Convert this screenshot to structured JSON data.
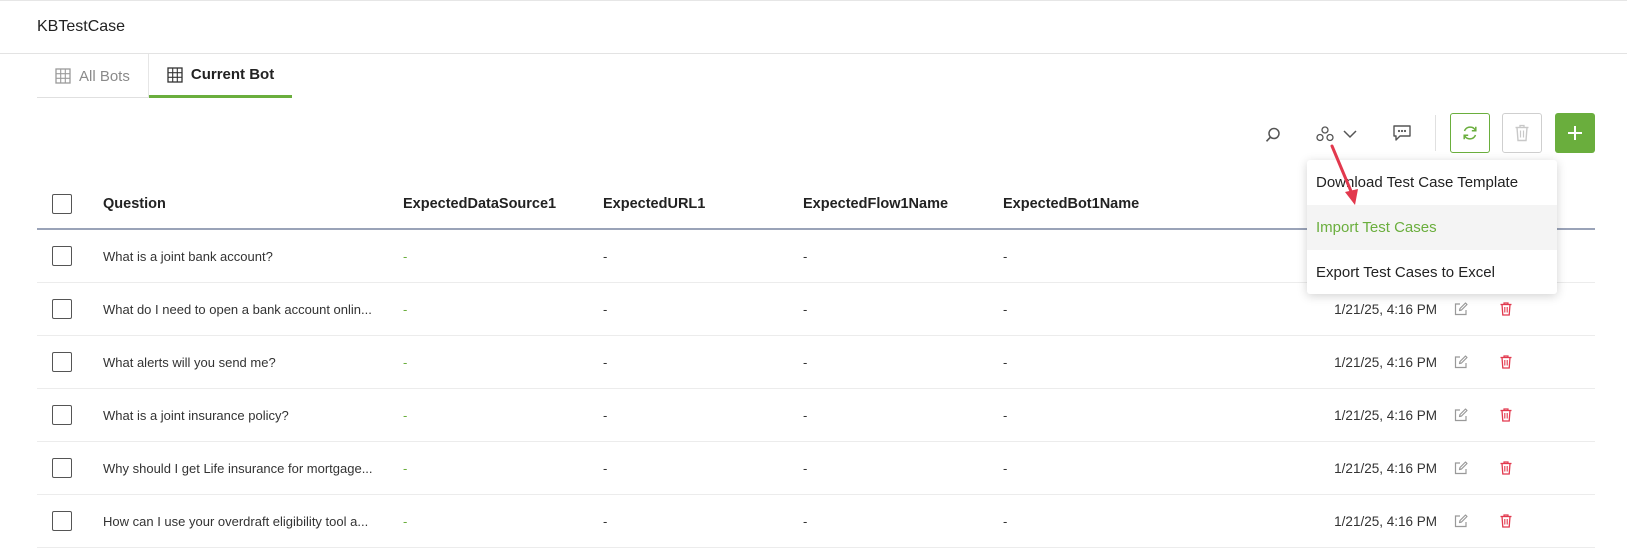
{
  "app": {
    "title": "KBTestCase"
  },
  "tabs": [
    {
      "label": "All Bots",
      "active": false
    },
    {
      "label": "Current Bot",
      "active": true
    }
  ],
  "colors": {
    "accent": "#6aae3d",
    "danger": "#e2384d",
    "header_rule": "#9aa3b8"
  },
  "toolbar": {
    "icons": [
      "search-icon",
      "group-icon",
      "chevron-down-icon",
      "comment-icon",
      "refresh-icon",
      "trash-icon",
      "plus-icon"
    ]
  },
  "table": {
    "columns": [
      "Question",
      "ExpectedDataSource1",
      "ExpectedURL1",
      "ExpectedFlow1Name",
      "ExpectedBot1Name"
    ],
    "rows": [
      {
        "question": "What is a joint bank account?",
        "source": "-",
        "url": "-",
        "flow": "-",
        "bot": "-",
        "date": ""
      },
      {
        "question": "What do I need to open a bank account onlin...",
        "source": "-",
        "url": "-",
        "flow": "-",
        "bot": "-",
        "date": "1/21/25, 4:16 PM"
      },
      {
        "question": "What alerts will you send me?",
        "source": "-",
        "url": "-",
        "flow": "-",
        "bot": "-",
        "date": "1/21/25, 4:16 PM"
      },
      {
        "question": "What is a joint insurance policy?",
        "source": "-",
        "url": "-",
        "flow": "-",
        "bot": "-",
        "date": "1/21/25, 4:16 PM"
      },
      {
        "question": "Why should I get Life insurance for mortgage...",
        "source": "-",
        "url": "-",
        "flow": "-",
        "bot": "-",
        "date": "1/21/25, 4:16 PM"
      },
      {
        "question": "How can I use your overdraft eligibility tool a...",
        "source": "-",
        "url": "-",
        "flow": "-",
        "bot": "-",
        "date": "1/21/25, 4:16 PM"
      }
    ]
  },
  "menu": {
    "items": [
      {
        "label": "Download Test Case Template",
        "highlight": false
      },
      {
        "label": "Import Test Cases",
        "highlight": true
      },
      {
        "label": "Export Test Cases to Excel",
        "highlight": false
      }
    ]
  }
}
